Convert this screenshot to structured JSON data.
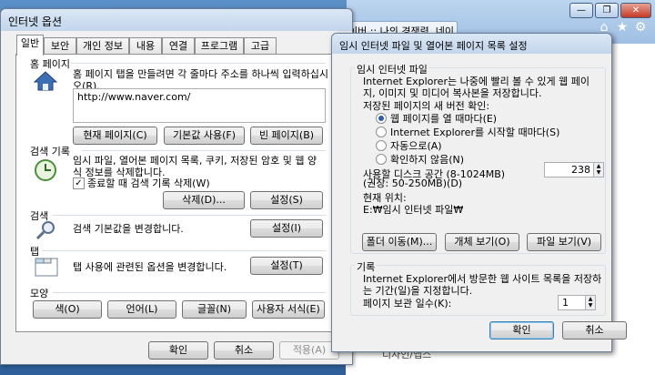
{
  "background_browser": {
    "tab_title": "이버 :: 나의 경쟁력, 네이...",
    "minimize": "—",
    "restore": "❐",
    "close": "✕",
    "footer_text": "디자인/앱스"
  },
  "internet_options": {
    "title": "인터넷 옵션",
    "tabs": [
      "일반",
      "보안",
      "개인 정보",
      "내용",
      "연결",
      "프로그램",
      "고급"
    ],
    "home": {
      "heading": "홈 페이지",
      "description": "홈 페이지 탭을 만들려면 각 줄마다 주소를 하나씩 입력하십시오(R).",
      "url": "http://www.naver.com/",
      "btn_current": "현재 페이지(C)",
      "btn_default": "기본값 사용(F)",
      "btn_blank": "빈 페이지(B)"
    },
    "history": {
      "heading": "검색 기록",
      "description": "임시 파일, 열어본 페이지 목록, 쿠키, 저장된 암호 및 웹 양식 정보를 삭제합니다.",
      "checkbox_label": "종료할 때 검색 기록 삭제(W)",
      "checkbox_checked": true,
      "btn_delete": "삭제(D)...",
      "btn_settings": "설정(S)"
    },
    "search": {
      "heading": "검색",
      "description": "검색 기본값을 변경합니다.",
      "btn_settings": "설정(I)"
    },
    "tabs_section": {
      "heading": "탭",
      "description": "탭 사용에 관련된 옵션을 변경합니다.",
      "btn_settings": "설정(T)"
    },
    "appearance": {
      "heading": "모양",
      "btn_colors": "색(O)",
      "btn_languages": "언어(L)",
      "btn_fonts": "글꼴(N)",
      "btn_accessibility": "사용자 서식(E)"
    },
    "footer": {
      "ok": "확인",
      "cancel": "취소",
      "apply": "적용(A)"
    }
  },
  "temp_files": {
    "title": "임시 인터넷 파일 및 열어본 페이지 목록 설정",
    "temp_group": {
      "heading": "임시 인터넷 파일",
      "description": "Internet Explorer는 나중에 빨리 볼 수 있게 웹 페이지, 이미지 및 미디어 복사본을 저장합니다.",
      "check_label": "저장된 페이지의 새 버전 확인:",
      "options": [
        {
          "label": "웹 페이지를 열 때마다(E)",
          "selected": true
        },
        {
          "label": "Internet Explorer를 시작할 때마다(S)",
          "selected": false
        },
        {
          "label": "자동으로(A)",
          "selected": false
        },
        {
          "label": "확인하지 않음(N)",
          "selected": false
        }
      ],
      "disk_label": "사용할 디스크 공간 (8-1024MB)",
      "disk_hint": "(권장: 50-250MB)(D)",
      "disk_value": "238",
      "location_label": "현재 위치:",
      "location_value": "E:₩임시 인터넷 파일₩",
      "btn_move": "폴더 이동(M)...",
      "btn_objects": "개체 보기(O)",
      "btn_files": "파일 보기(V)"
    },
    "history_group": {
      "heading": "기록",
      "description": "Internet Explorer에서 방문한 웹 사이트 목록을 저장하는 기간(일)을 지정합니다.",
      "days_label": "페이지 보관 일수(K):",
      "days_value": "1"
    },
    "ok": "확인",
    "cancel": "취소"
  }
}
